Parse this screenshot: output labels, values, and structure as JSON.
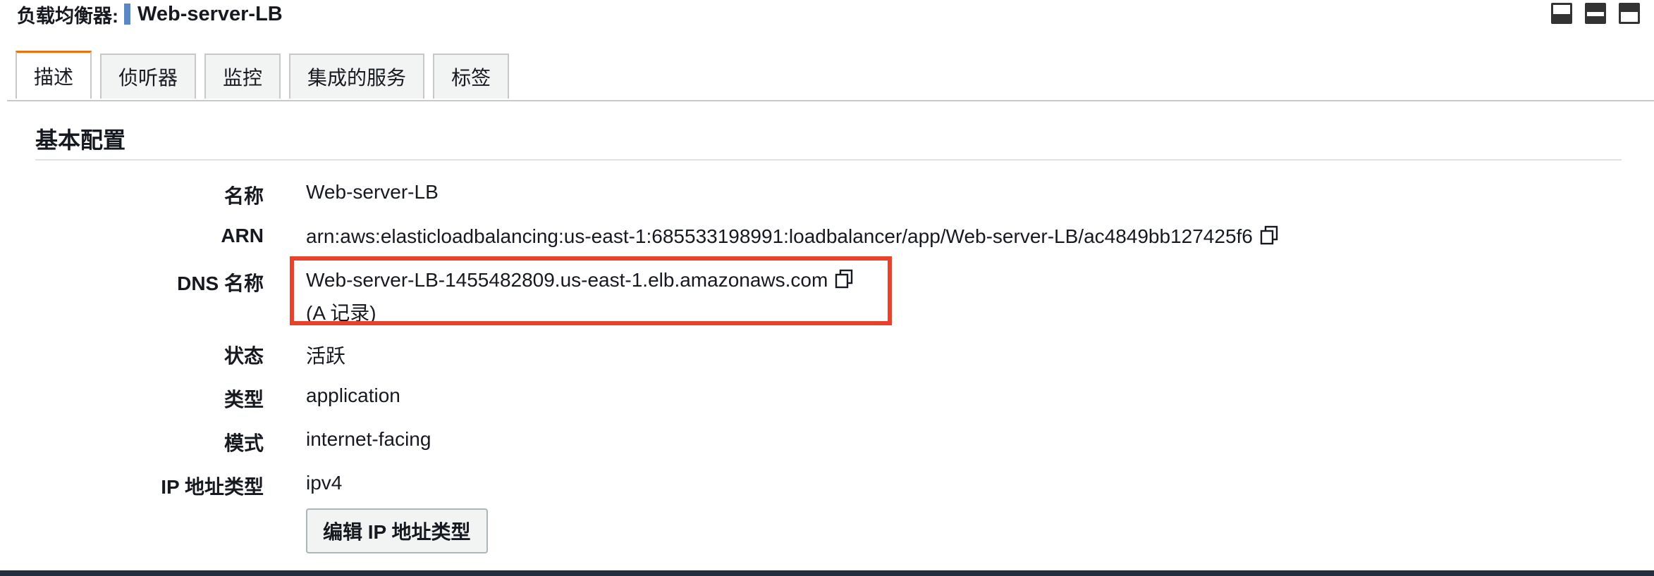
{
  "header": {
    "label": "负载均衡器:",
    "name": "Web-server-LB",
    "accent_color": "#5b87c4"
  },
  "view_icons": [
    "panel-bottom-icon",
    "panel-split-icon",
    "panel-top-icon"
  ],
  "tabs": [
    {
      "label": "描述",
      "active": true
    },
    {
      "label": "侦听器",
      "active": false
    },
    {
      "label": "监控",
      "active": false
    },
    {
      "label": "集成的服务",
      "active": false
    },
    {
      "label": "标签",
      "active": false
    }
  ],
  "section": {
    "title": "基本配置"
  },
  "details": {
    "name": {
      "label": "名称",
      "value": "Web-server-LB"
    },
    "arn": {
      "label": "ARN",
      "value": "arn:aws:elasticloadbalancing:us-east-1:685533198991:loadbalancer/app/Web-server-LB/ac4849bb127425f6"
    },
    "dns": {
      "label": "DNS 名称",
      "value": "Web-server-LB-1455482809.us-east-1.elb.amazonaws.com",
      "record": "(A 记录)"
    },
    "state": {
      "label": "状态",
      "value": "活跃"
    },
    "type": {
      "label": "类型",
      "value": "application"
    },
    "scheme": {
      "label": "模式",
      "value": "internet-facing"
    },
    "ip_type": {
      "label": "IP 地址类型",
      "value": "ipv4"
    }
  },
  "edit_button": {
    "label": "编辑 IP 地址类型"
  },
  "highlight_color": "#e8412c",
  "tab_active_color": "#ec7211"
}
